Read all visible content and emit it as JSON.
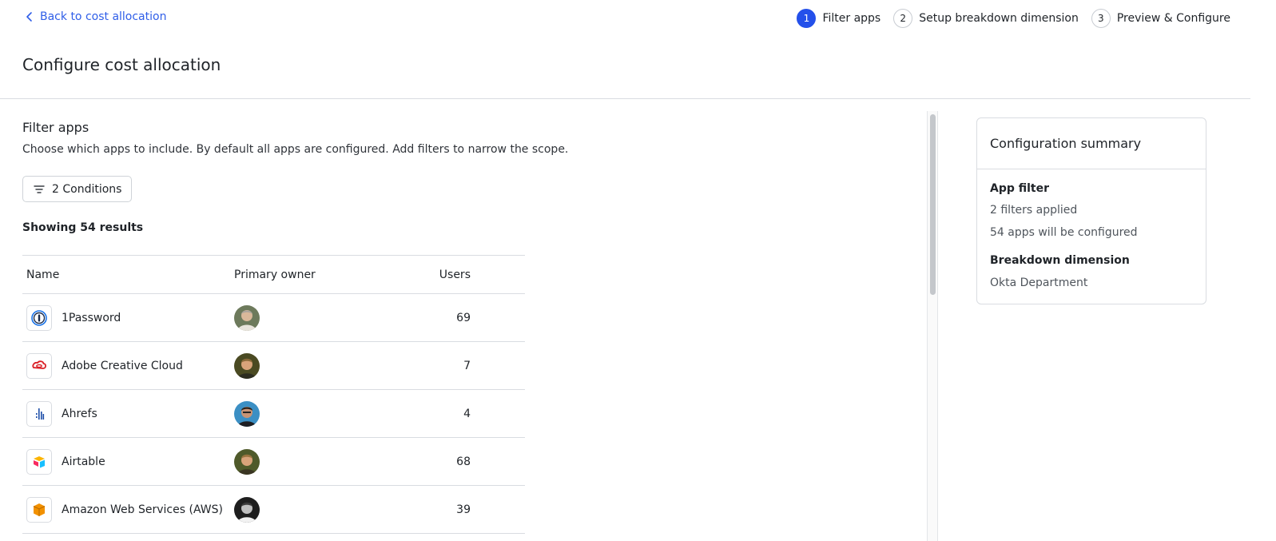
{
  "nav": {
    "back_label": "Back to cost allocation",
    "steps": [
      {
        "num": "1",
        "label": "Filter apps"
      },
      {
        "num": "2",
        "label": "Setup breakdown dimension"
      },
      {
        "num": "3",
        "label": "Preview & Configure"
      }
    ],
    "active_step": 1
  },
  "page": {
    "title": "Configure cost allocation"
  },
  "filter": {
    "title": "Filter apps",
    "description": "Choose which apps to include. By default all apps are configured. Add filters to narrow the scope.",
    "conditions_label": "2 Conditions",
    "results_label": "Showing 54 results"
  },
  "table": {
    "headers": {
      "name": "Name",
      "owner": "Primary owner",
      "users": "Users"
    },
    "rows": [
      {
        "name": "1Password",
        "logo": "1password-icon",
        "users": "69"
      },
      {
        "name": "Adobe Creative Cloud",
        "logo": "adobe-creative-cloud-icon",
        "users": "7"
      },
      {
        "name": "Ahrefs",
        "logo": "ahrefs-icon",
        "users": "4"
      },
      {
        "name": "Airtable",
        "logo": "airtable-icon",
        "users": "68"
      },
      {
        "name": "Amazon Web Services (AWS)",
        "logo": "aws-icon",
        "users": "39"
      }
    ]
  },
  "summary": {
    "title": "Configuration summary",
    "app_filter_label": "App filter",
    "filters_applied": "2 filters applied",
    "apps_configured": "54 apps will be configured",
    "breakdown_label": "Breakdown dimension",
    "breakdown_value": "Okta Department"
  },
  "colors": {
    "accent": "#2450ea",
    "link": "#2f5ee8",
    "border": "#d9dce1"
  }
}
